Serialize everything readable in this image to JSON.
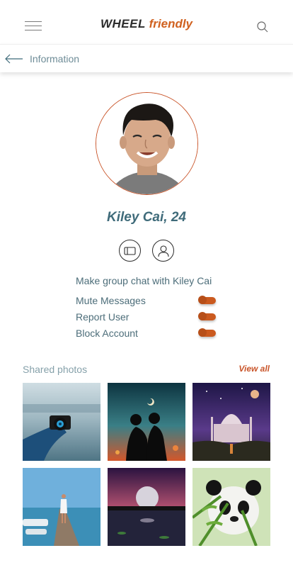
{
  "header": {
    "logo_part1": "WHEEL",
    "logo_part2": "friendly"
  },
  "subheader": {
    "title": "Information"
  },
  "profile": {
    "name": "Kiley Cai, 24"
  },
  "menu": {
    "group_chat": "Make group chat with Kiley Cai",
    "items": [
      {
        "label": "Mute Messages"
      },
      {
        "label": "Report User"
      },
      {
        "label": "Block Account"
      }
    ]
  },
  "photos": {
    "title": "Shared photos",
    "view_all": "View all"
  },
  "colors": {
    "accent": "#c9552a",
    "text": "#4c6d79"
  }
}
